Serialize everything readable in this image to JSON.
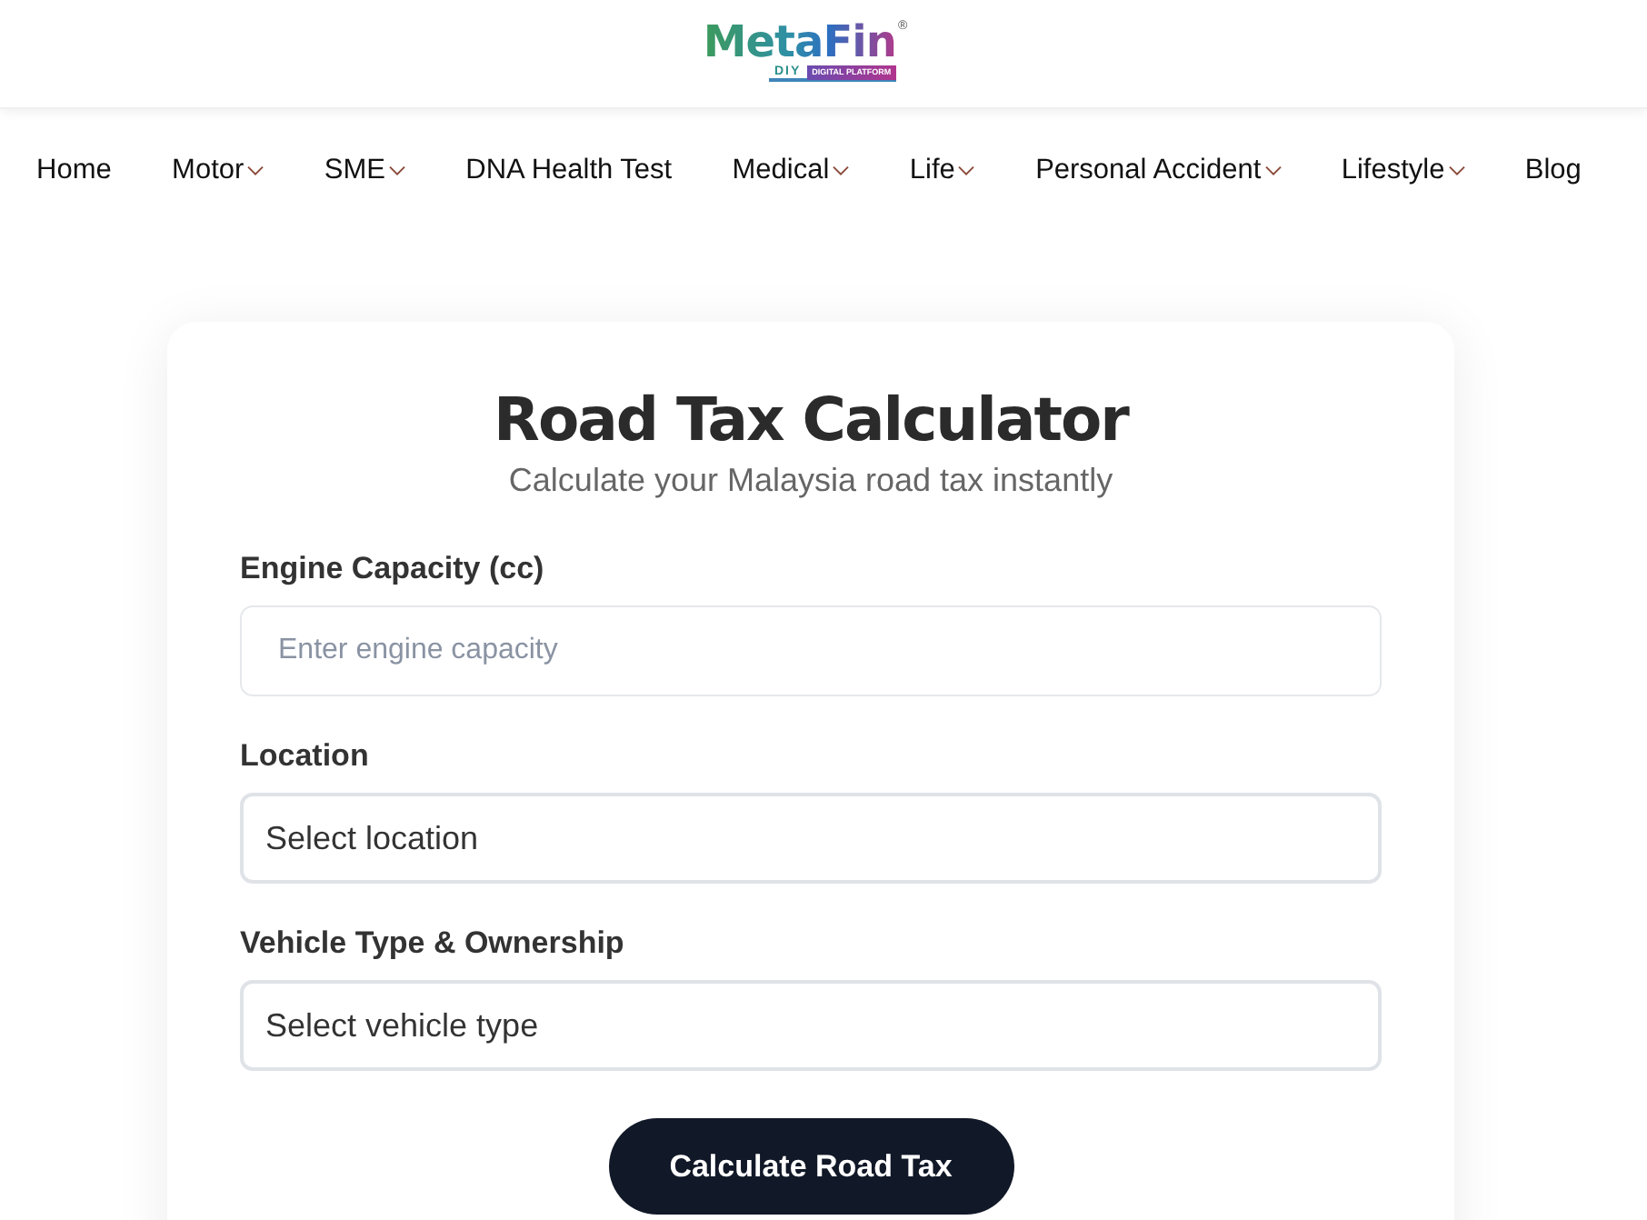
{
  "header": {
    "logo": {
      "name": "MetaFin",
      "mark": "®",
      "tag": "DIY",
      "tagline": "DIGITAL PLATFORM"
    }
  },
  "nav": {
    "items": [
      {
        "label": "Home",
        "has_menu": false
      },
      {
        "label": "Motor",
        "has_menu": true
      },
      {
        "label": "SME",
        "has_menu": true
      },
      {
        "label": "DNA Health Test",
        "has_menu": false
      },
      {
        "label": "Medical",
        "has_menu": true
      },
      {
        "label": "Life",
        "has_menu": true
      },
      {
        "label": "Personal Accident",
        "has_menu": true
      },
      {
        "label": "Lifestyle",
        "has_menu": true
      },
      {
        "label": "Blog",
        "has_menu": false
      }
    ]
  },
  "calculator": {
    "title": "Road Tax Calculator",
    "subtitle": "Calculate your Malaysia road tax instantly",
    "fields": [
      {
        "kind": "input",
        "label": "Engine Capacity (cc)",
        "placeholder": "Enter engine capacity"
      },
      {
        "kind": "select",
        "label": "Location",
        "value": "Select location"
      },
      {
        "kind": "select",
        "label": "Vehicle Type & Ownership",
        "value": "Select vehicle type"
      }
    ],
    "button": "Calculate Road Tax"
  }
}
